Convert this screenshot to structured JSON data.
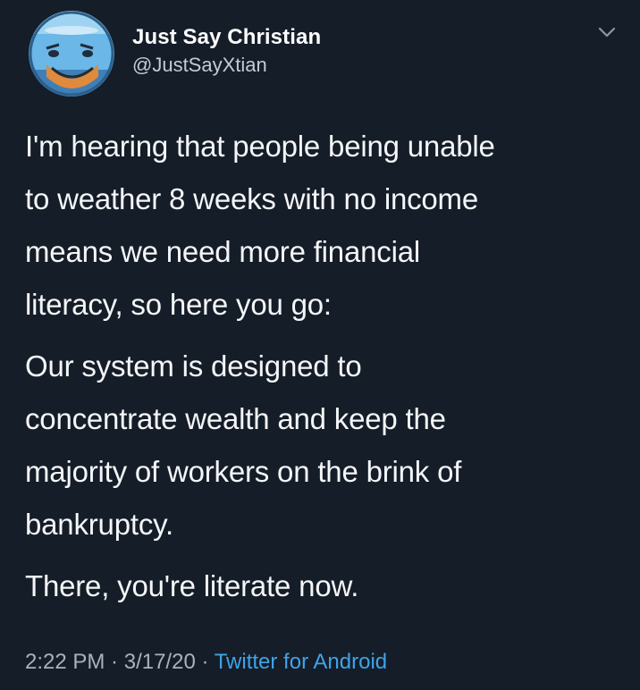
{
  "tweet": {
    "display_name": "Just Say Christian",
    "handle": "@JustSayXtian",
    "paragraphs": [
      "I'm hearing that people being unable\nto weather 8 weeks with no income\nmeans we need more financial\nliteracy, so here you go:",
      "Our system is designed to\nconcentrate wealth and keep the\nmajority of workers on the brink of\nbankruptcy.",
      "There, you're literate now."
    ],
    "time": "2:22 PM",
    "sep": " · ",
    "date": "3/17/20",
    "source": "Twitter for Android"
  },
  "icons": {
    "caret": "chevron-down-icon",
    "avatar": "fishbowl-avatar"
  },
  "colors": {
    "background": "#151d28",
    "text": "#f4f6f8",
    "muted": "#a7b2bf",
    "link": "#3ea4e8"
  }
}
